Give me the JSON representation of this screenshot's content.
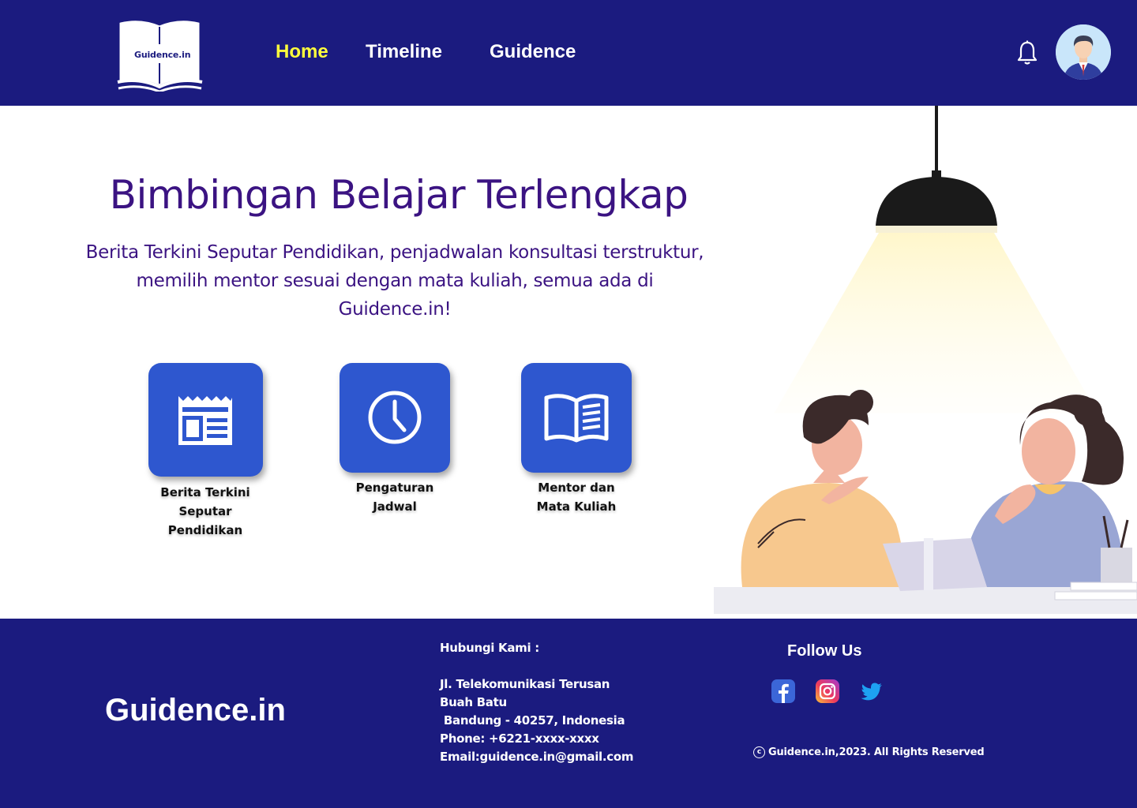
{
  "header": {
    "logo_text": "Guidence.in",
    "nav": [
      {
        "label": "Home",
        "active": true
      },
      {
        "label": "Timeline",
        "active": false
      },
      {
        "label": "Guidence",
        "active": false
      }
    ],
    "icons": {
      "notification": "bell-icon",
      "profile": "user-avatar"
    }
  },
  "hero": {
    "title": "Bimbingan Belajar Terlengkap",
    "description_lines": [
      "Berita Terkini Seputar Pendidikan, penjadwalan konsultasi terstruktur,",
      "memilih mentor sesuai dengan mata kuliah, semua ada di",
      "Guidence.in!"
    ]
  },
  "features": [
    {
      "icon": "newspaper-icon",
      "label_lines": [
        "Berita Terkini",
        "Seputar",
        "Pendidikan"
      ]
    },
    {
      "icon": "clock-icon",
      "label_lines": [
        "Pengaturan",
        "Jadwal"
      ]
    },
    {
      "icon": "book-icon",
      "label_lines": [
        "Mentor dan",
        "Mata Kuliah"
      ]
    }
  ],
  "footer": {
    "brand": "Guidence.in",
    "contact": {
      "heading": "Hubungi Kami :",
      "lines": [
        "Jl. Telekomunikasi Terusan",
        "Buah Batu",
        " Bandung - 40257, Indonesia",
        "Phone: +6221-xxxx-xxxx",
        "Email:guidence.in@gmail.com"
      ]
    },
    "follow_title": "Follow Us",
    "socials": [
      "facebook-icon",
      "instagram-icon",
      "twitter-icon"
    ],
    "copyright": "Guidence.in,2023. All Rights Reserved"
  },
  "colors": {
    "primary": "#1b1b7f",
    "nav_active": "#ffff3c",
    "heading": "#3b1382",
    "card": "#2e57cf"
  }
}
